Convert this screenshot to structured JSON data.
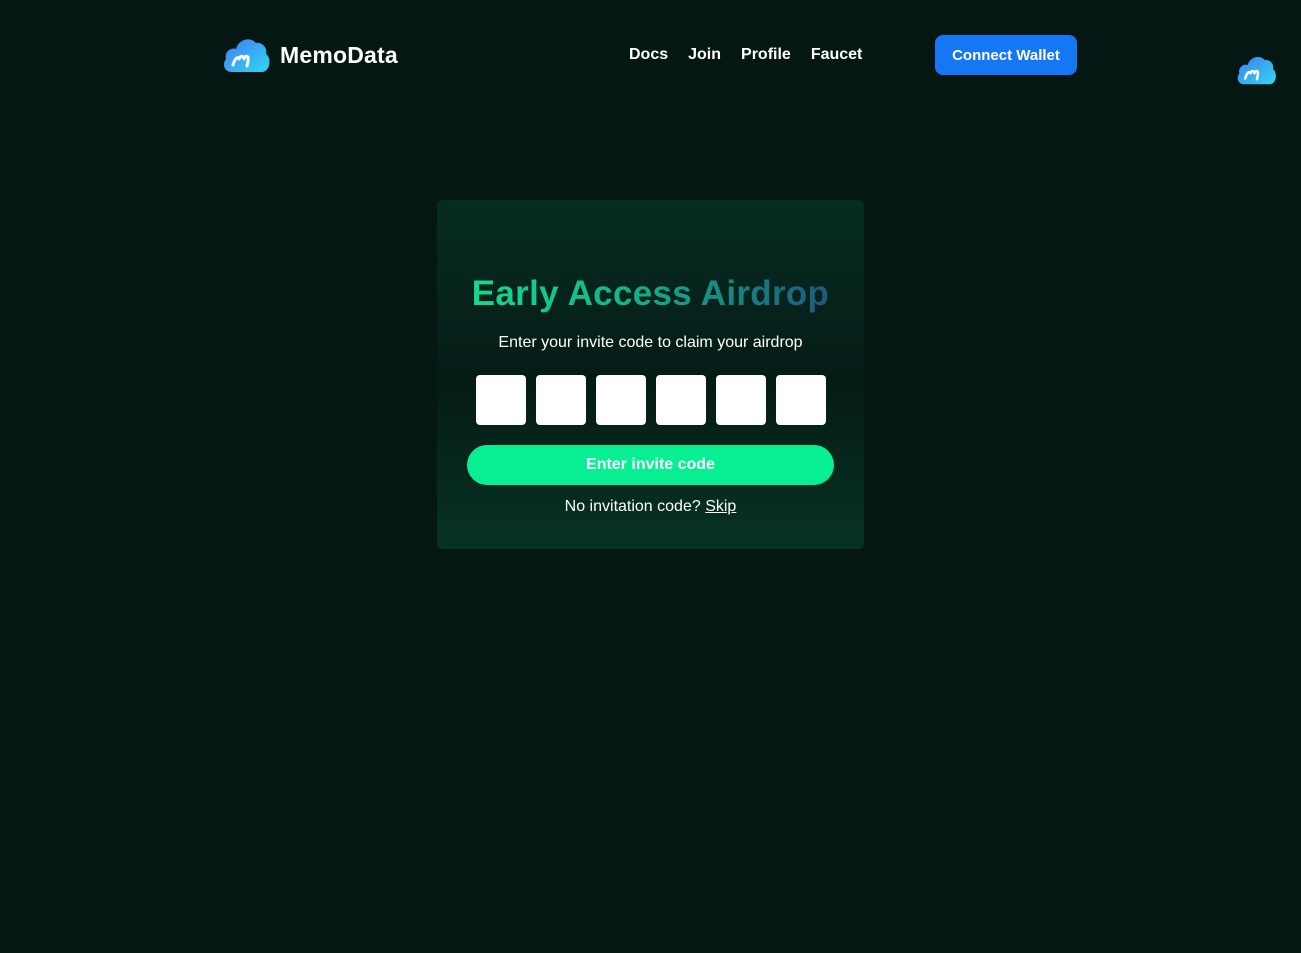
{
  "header": {
    "brand_name": "MemoData",
    "logo_icon": "memodata-cloud-logo-icon",
    "nav": [
      {
        "label": "Docs"
      },
      {
        "label": "Join"
      },
      {
        "label": "Profile"
      },
      {
        "label": "Faucet"
      }
    ],
    "connect_wallet_label": "Connect Wallet"
  },
  "card": {
    "title": "Early Access Airdrop",
    "subtitle": "Enter your invite code to claim your airdrop",
    "code_inputs": [
      "",
      "",
      "",
      "",
      "",
      ""
    ],
    "submit_label": "Enter invite code",
    "no_code_text": "No invitation code?",
    "skip_label": "Skip"
  },
  "colors": {
    "background": "#051713",
    "card_top": "#062d22",
    "card_bottom": "#063323",
    "accent_green": "#08ef93",
    "wallet_blue": "#1677f5",
    "title_gradient_start": "#16e38d",
    "title_gradient_end": "#1e4a79",
    "logo_cyan": "#33d7f0",
    "logo_blue": "#3f7df3"
  }
}
